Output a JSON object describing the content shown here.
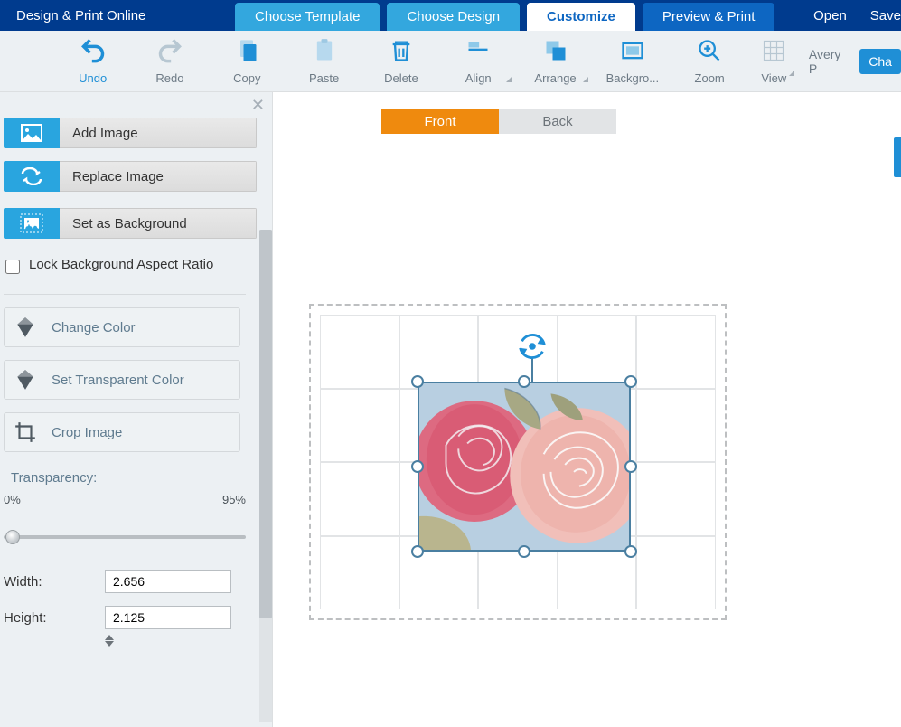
{
  "top": {
    "brand": "Design & Print Online",
    "steps": [
      {
        "label": "Choose Template"
      },
      {
        "label": "Choose Design"
      },
      {
        "label": "Customize"
      },
      {
        "label": "Preview & Print"
      }
    ],
    "active_step": 2,
    "open": "Open",
    "save": "Save"
  },
  "toolbar": {
    "undo": "Undo",
    "redo": "Redo",
    "copy": "Copy",
    "paste": "Paste",
    "delete": "Delete",
    "align": "Align",
    "arrange": "Arrange",
    "background": "Backgro...",
    "zoom": "Zoom",
    "view": "View",
    "search_label": "Avery P",
    "change": "Cha"
  },
  "sidebar": {
    "add_image": "Add Image",
    "replace_image": "Replace Image",
    "set_background": "Set as Background",
    "lock_aspect": "Lock Background Aspect Ratio",
    "change_color": "Change Color",
    "set_trans_color": "Set Transparent Color",
    "crop_image": "Crop Image",
    "transparency_label": "Transparency:",
    "slider_min": "0%",
    "slider_max": "95%",
    "width_label": "Width:",
    "height_label": "Height:",
    "width_value": "2.656",
    "height_value": "2.125"
  },
  "canvas": {
    "front": "Front",
    "back": "Back"
  }
}
